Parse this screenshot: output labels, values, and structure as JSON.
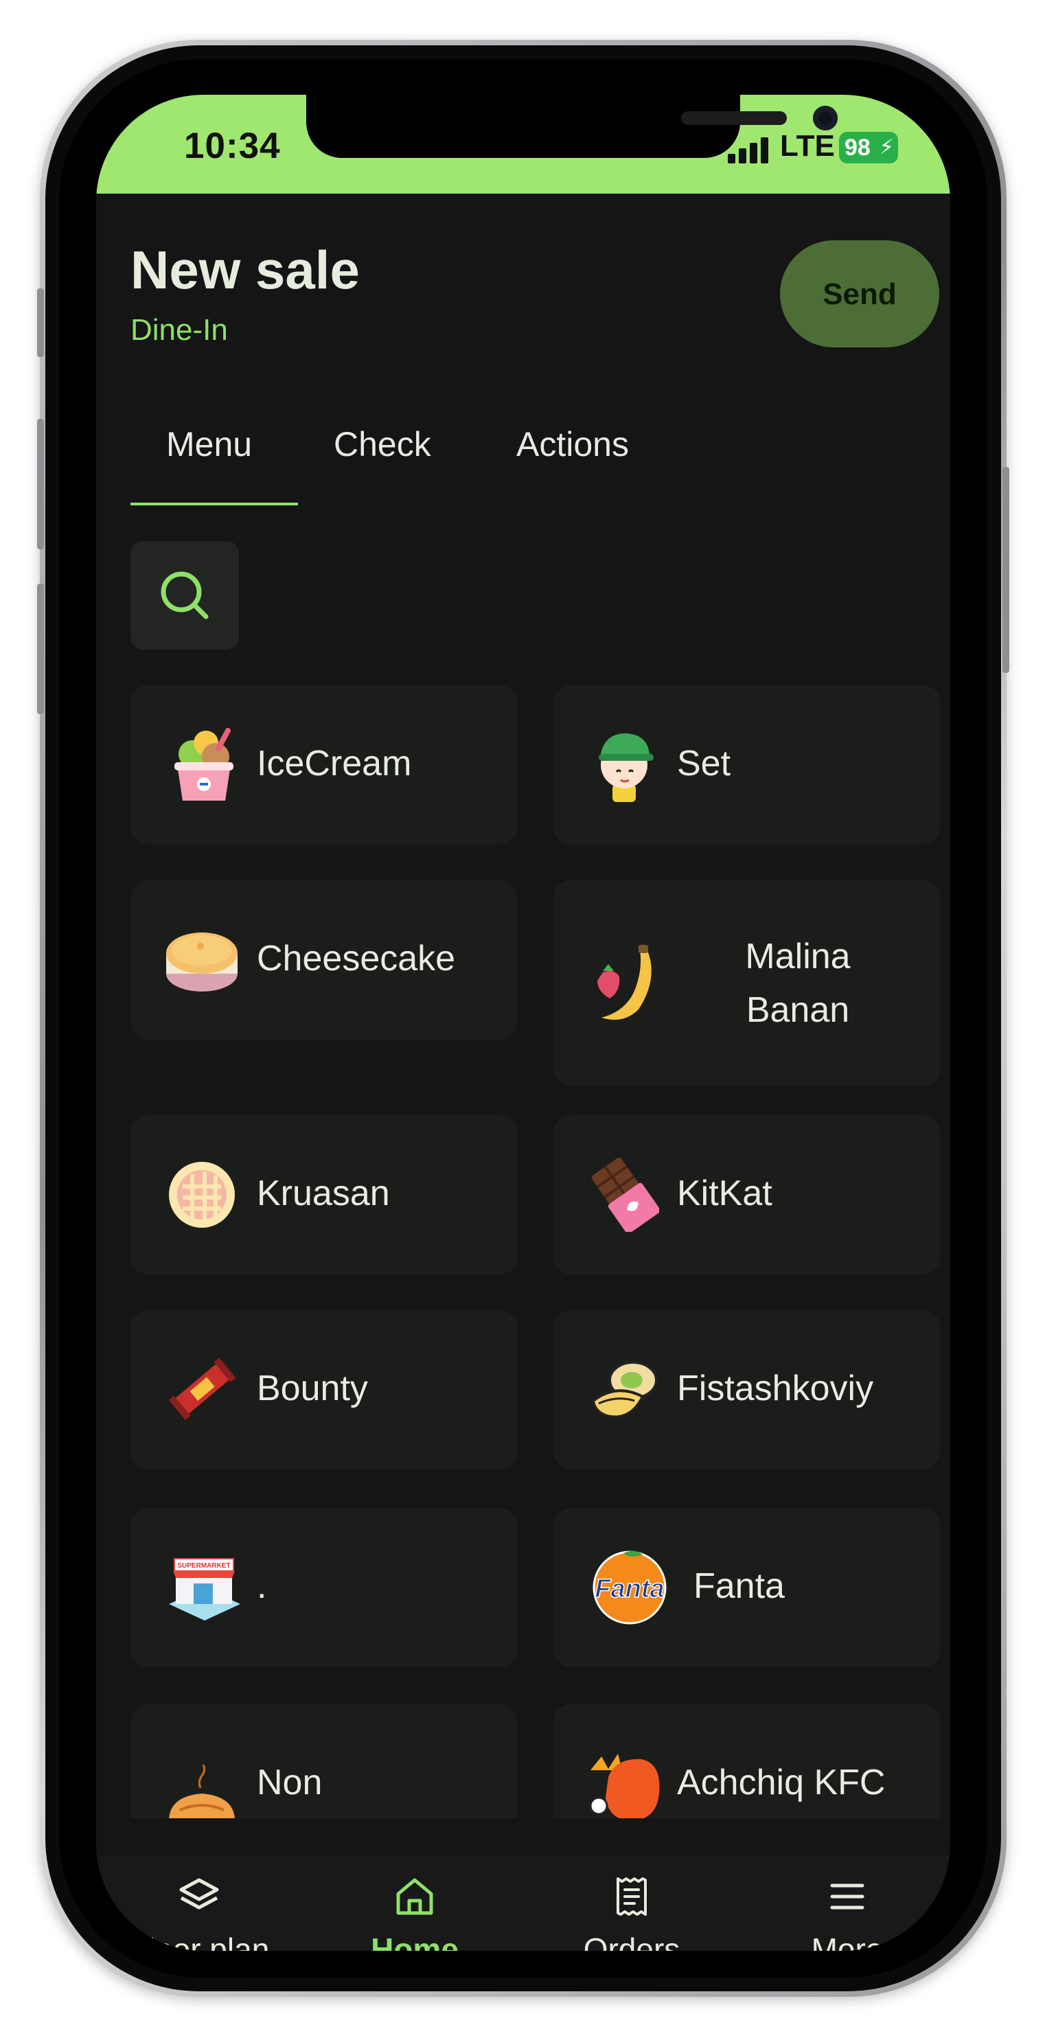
{
  "status_bar": {
    "time": "10:34",
    "network": "LTE",
    "battery": "98"
  },
  "header": {
    "title": "New sale",
    "subtitle": "Dine-In",
    "send_label": "Send"
  },
  "tabs": [
    {
      "label": "Menu",
      "active": true
    },
    {
      "label": "Check",
      "active": false
    },
    {
      "label": "Actions",
      "active": false
    }
  ],
  "search": {
    "icon": "search-icon"
  },
  "menu_items": [
    {
      "label": "IceCream",
      "icon": "ice-cream-icon"
    },
    {
      "label": "Set",
      "icon": "kid-face-icon"
    },
    {
      "label": "Cheesecake",
      "icon": "cheesecake-icon"
    },
    {
      "label_line1": "Malina",
      "label_line2": "Banan",
      "icon": "strawberry-banana-icon"
    },
    {
      "label": "Kruasan",
      "icon": "pie-icon"
    },
    {
      "label": "KitKat",
      "icon": "chocolate-bar-icon"
    },
    {
      "label": "Bounty",
      "icon": "candy-bar-icon"
    },
    {
      "label": "Fistashkoviy",
      "icon": "pistachio-icon"
    },
    {
      "label": ".",
      "icon": "supermarket-icon",
      "icon_text": "SUPERMARKET"
    },
    {
      "label": "Fanta",
      "icon": "fanta-logo-icon",
      "icon_text": "Fanta"
    },
    {
      "label": "Non",
      "icon": "bread-icon"
    },
    {
      "label": "Achchiq KFC",
      "icon": "spicy-chicken-icon"
    }
  ],
  "bottom_nav": [
    {
      "label": "Floor plan",
      "icon": "layers-icon",
      "active": false
    },
    {
      "label": "Home",
      "icon": "home-icon",
      "active": true
    },
    {
      "label": "Orders",
      "icon": "receipt-icon",
      "active": false
    },
    {
      "label": "More",
      "icon": "menu-icon",
      "active": false
    }
  ],
  "colors": {
    "accent": "#8ee06a",
    "status_bar": "#a0e76f",
    "background": "#141514",
    "card": "#1b1d1b",
    "send_button": "#4c6e36"
  }
}
